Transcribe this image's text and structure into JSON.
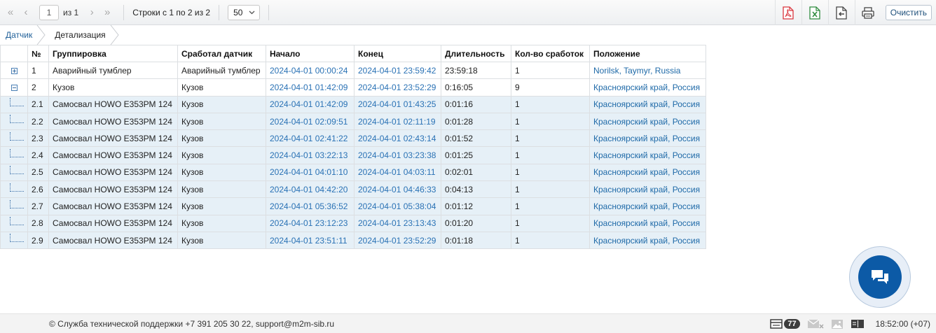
{
  "toolbar": {
    "page_value": "1",
    "of_label": "из 1",
    "rows_label": "Строки с 1 по 2 из 2",
    "page_size": "50",
    "clear_label": "Очистить",
    "nav_icons": [
      "first-page-icon",
      "prev-page-icon",
      "next-page-icon",
      "last-page-icon"
    ],
    "export_icons": [
      "pdf-export-icon",
      "excel-export-icon",
      "import-icon",
      "print-icon"
    ]
  },
  "breadcrumb": {
    "items": [
      "Датчик",
      "Детализация"
    ]
  },
  "table": {
    "columns": [
      "№",
      "Группировка",
      "Сработал датчик",
      "Начало",
      "Конец",
      "Длительность",
      "Кол-во сработок",
      "Положение"
    ],
    "rows": [
      {
        "expander": "plus",
        "num": "1",
        "group": "Аварийный тумблер",
        "sensor": "Аварийный тумблер",
        "start": "2024-04-01 00:00:24",
        "end": "2024-04-01 23:59:42",
        "duration": "23:59:18",
        "count": "1",
        "location": "Norilsk, Taymyr, Russia"
      },
      {
        "expander": "minus",
        "num": "2",
        "group": "Кузов",
        "sensor": "Кузов",
        "start": "2024-04-01 01:42:09",
        "end": "2024-04-01 23:52:29",
        "duration": "0:16:05",
        "count": "9",
        "location": "Красноярский край, Россия"
      },
      {
        "expander": "tree",
        "num": "2.1",
        "group": "Самосвал HOWO Е353РМ 124",
        "sensor": "Кузов",
        "start": "2024-04-01 01:42:09",
        "end": "2024-04-01 01:43:25",
        "duration": "0:01:16",
        "count": "1",
        "location": "Красноярский край, Россия"
      },
      {
        "expander": "tree",
        "num": "2.2",
        "group": "Самосвал HOWO Е353РМ 124",
        "sensor": "Кузов",
        "start": "2024-04-01 02:09:51",
        "end": "2024-04-01 02:11:19",
        "duration": "0:01:28",
        "count": "1",
        "location": "Красноярский край, Россия"
      },
      {
        "expander": "tree",
        "num": "2.3",
        "group": "Самосвал HOWO Е353РМ 124",
        "sensor": "Кузов",
        "start": "2024-04-01 02:41:22",
        "end": "2024-04-01 02:43:14",
        "duration": "0:01:52",
        "count": "1",
        "location": "Красноярский край, Россия"
      },
      {
        "expander": "tree",
        "num": "2.4",
        "group": "Самосвал HOWO Е353РМ 124",
        "sensor": "Кузов",
        "start": "2024-04-01 03:22:13",
        "end": "2024-04-01 03:23:38",
        "duration": "0:01:25",
        "count": "1",
        "location": "Красноярский край, Россия"
      },
      {
        "expander": "tree",
        "num": "2.5",
        "group": "Самосвал HOWO Е353РМ 124",
        "sensor": "Кузов",
        "start": "2024-04-01 04:01:10",
        "end": "2024-04-01 04:03:11",
        "duration": "0:02:01",
        "count": "1",
        "location": "Красноярский край, Россия"
      },
      {
        "expander": "tree",
        "num": "2.6",
        "group": "Самосвал HOWO Е353РМ 124",
        "sensor": "Кузов",
        "start": "2024-04-01 04:42:20",
        "end": "2024-04-01 04:46:33",
        "duration": "0:04:13",
        "count": "1",
        "location": "Красноярский край, Россия"
      },
      {
        "expander": "tree",
        "num": "2.7",
        "group": "Самосвал HOWO Е353РМ 124",
        "sensor": "Кузов",
        "start": "2024-04-01 05:36:52",
        "end": "2024-04-01 05:38:04",
        "duration": "0:01:12",
        "count": "1",
        "location": "Красноярский край, Россия"
      },
      {
        "expander": "tree",
        "num": "2.8",
        "group": "Самосвал HOWO Е353РМ 124",
        "sensor": "Кузов",
        "start": "2024-04-01 23:12:23",
        "end": "2024-04-01 23:13:43",
        "duration": "0:01:20",
        "count": "1",
        "location": "Красноярский край, Россия"
      },
      {
        "expander": "tree",
        "num": "2.9",
        "group": "Самосвал HOWO Е353РМ 124",
        "sensor": "Кузов",
        "start": "2024-04-01 23:51:11",
        "end": "2024-04-01 23:52:29",
        "duration": "0:01:18",
        "count": "1",
        "location": "Красноярский край, Россия"
      }
    ]
  },
  "footer": {
    "support": "© Служба технической поддержки +7 391 205 30 22, support@m2m-sib.ru",
    "messages_count": "77",
    "clock": "18:52:00 (+07)",
    "icons": [
      "messages-icon",
      "mail-icon",
      "image-icon",
      "book-icon"
    ]
  },
  "chat": {
    "icon": "chat-icon"
  },
  "colors": {
    "link": "#1f6aa8",
    "child_row_bg": "#e6f0f7",
    "chat_button": "#0c5aa6",
    "pdf": "#d9363e",
    "excel": "#2e8b3e"
  }
}
